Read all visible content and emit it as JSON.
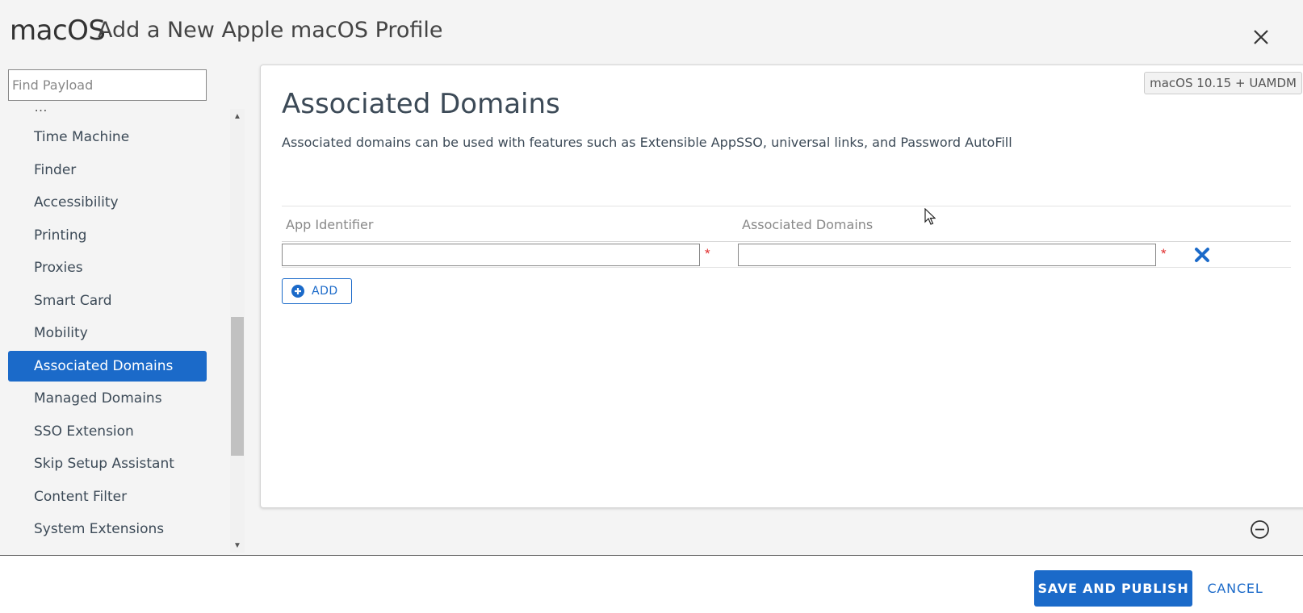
{
  "header": {
    "brand": "macOS",
    "title": "Add a New Apple macOS Profile"
  },
  "sidebar": {
    "search_placeholder": "Find Payload",
    "items": [
      {
        "label": "Time Machine",
        "active": false
      },
      {
        "label": "Finder",
        "active": false
      },
      {
        "label": "Accessibility",
        "active": false
      },
      {
        "label": "Printing",
        "active": false
      },
      {
        "label": "Proxies",
        "active": false
      },
      {
        "label": "Smart Card",
        "active": false
      },
      {
        "label": "Mobility",
        "active": false
      },
      {
        "label": "Associated Domains",
        "active": true
      },
      {
        "label": "Managed Domains",
        "active": false
      },
      {
        "label": "SSO Extension",
        "active": false
      },
      {
        "label": "Skip Setup Assistant",
        "active": false
      },
      {
        "label": "Content Filter",
        "active": false
      },
      {
        "label": "System Extensions",
        "active": false
      }
    ]
  },
  "panel": {
    "badge": "macOS 10.15 + UAMDM",
    "title": "Associated Domains",
    "description": "Associated domains can be used with features such as Extensible AppSSO, universal links, and Password AutoFill",
    "columns": [
      "App Identifier",
      "Associated Domains"
    ],
    "row": {
      "app_identifier": "",
      "associated_domains": ""
    },
    "required_mark": "*",
    "add_label": "ADD"
  },
  "footer": {
    "save_label": "SAVE AND PUBLISH",
    "cancel_label": "CANCEL"
  },
  "colors": {
    "accent": "#1b6ac9",
    "required": "#e02d2d"
  }
}
